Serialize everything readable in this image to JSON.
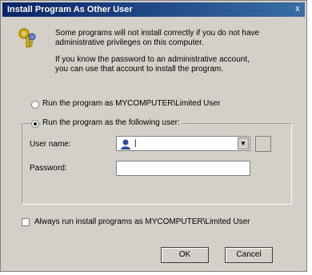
{
  "window": {
    "title": "Install Program As Other User",
    "close_symbol": "x"
  },
  "info": {
    "line1": "Some programs will not install correctly if you do not have",
    "line2": "administrative privileges on this computer.",
    "line3": "If you know the password to an administrative account,",
    "line4": "you can use that account to install the program."
  },
  "options": {
    "current_user_label": "Run the program as MYCOMPUTER\\Limited User",
    "following_user_label": "Run the program as the following user:",
    "selected": "following_user"
  },
  "form": {
    "username_label": "User name:",
    "username_value": "|",
    "password_label": "Password:",
    "password_value": ""
  },
  "always_run_label": "Always run install programs as MYCOMPUTER\\Limited User",
  "buttons": {
    "ok": "OK",
    "cancel": "Cancel"
  },
  "icons": {
    "keys": "keys-icon",
    "user": "user-icon",
    "dropdown": "chevron-down-icon",
    "browse": "browse-icon"
  }
}
